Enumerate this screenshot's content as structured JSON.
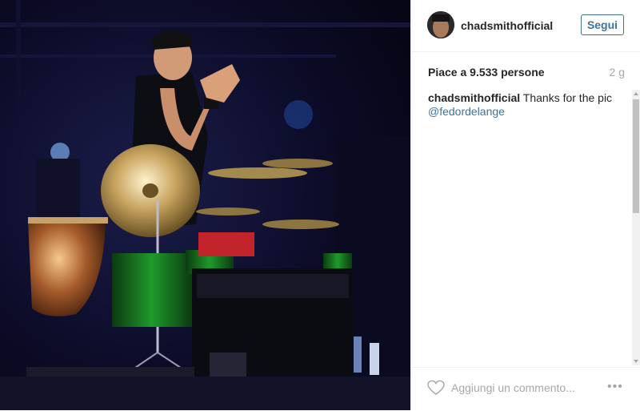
{
  "post": {
    "username": "chadsmithofficial",
    "follow_label": "Segui",
    "likes_text": "Piace a 9.533 persone",
    "age": "2 g",
    "caption": {
      "user": "chadsmithofficial",
      "text": "Thanks for the pic",
      "mention": "@fedordelange"
    },
    "comment_placeholder": "Aggiungi un commento...",
    "more_label": "•••"
  },
  "icons": {
    "heart": "heart-icon",
    "more": "more-options-icon"
  },
  "colors": {
    "link": "#3f729b",
    "text": "#262626",
    "muted": "#a5a7aa"
  }
}
